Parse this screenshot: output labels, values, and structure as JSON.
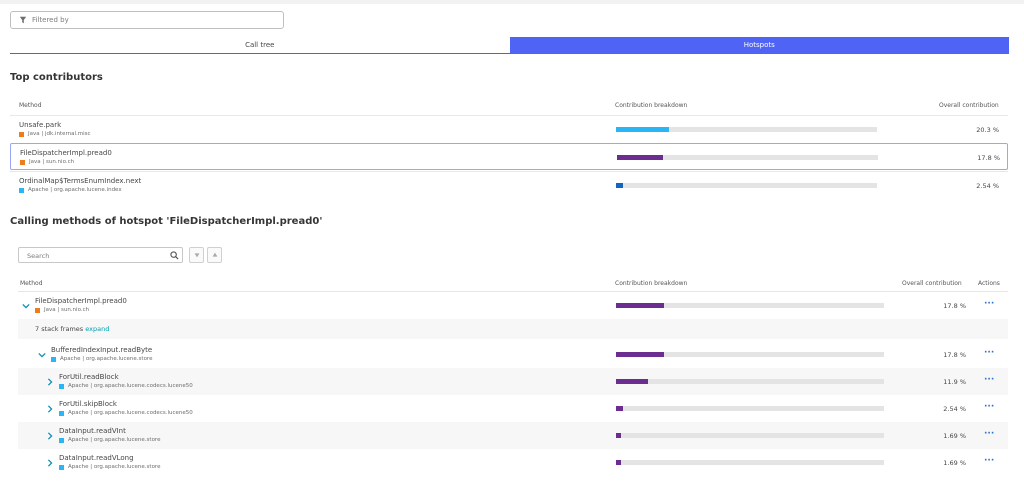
{
  "filter": {
    "placeholder": "Filtered by"
  },
  "tabs": [
    {
      "label": "Call tree",
      "active": false
    },
    {
      "label": "Hotspots",
      "active": true
    }
  ],
  "top_contributors": {
    "title": "Top contributors",
    "headers": {
      "method": "Method",
      "breakdown": "Contribution breakdown",
      "overall": "Overall contribution"
    },
    "rows": [
      {
        "name": "Unsafe.park",
        "meta": "Java | jdk.internal.misc",
        "color": "#ef7c1a",
        "bar_color": "#2ab6f4",
        "fraction": 0.203,
        "pct": "20.3 %",
        "selected": false
      },
      {
        "name": "FileDispatcherImpl.pread0",
        "meta": "Java | sun.nio.ch",
        "color": "#ef7c1a",
        "bar_color": "#6b2d8f",
        "fraction": 0.178,
        "pct": "17.8 %",
        "selected": true
      },
      {
        "name": "OrdinalMap$TermsEnumIndex.next",
        "meta": "Apache | org.apache.lucene.index",
        "color": "#2ab6f4",
        "bar_color": "#1565c0",
        "fraction": 0.0254,
        "pct": "2.54 %",
        "selected": false
      }
    ]
  },
  "calling": {
    "title": "Calling methods of hotspot 'FileDispatcherImpl.pread0'",
    "search_placeholder": "Search",
    "headers": {
      "method": "Method",
      "breakdown": "Contribution breakdown",
      "overall": "Overall contribution",
      "actions": "Actions"
    },
    "stack_frames": {
      "text": "7 stack frames",
      "link": "expand"
    },
    "rows": [
      {
        "name": "FileDispatcherImpl.pread0",
        "meta": "Java | sun.nio.ch",
        "color": "#ef7c1a",
        "fraction": 0.178,
        "pct": "17.8 %",
        "expanded": true
      },
      {
        "name": "BufferedIndexInput.readByte",
        "meta": "Apache | org.apache.lucene.store",
        "color": "#2ab6f4",
        "fraction": 0.178,
        "pct": "17.8 %",
        "expanded": true
      },
      {
        "name": "ForUtil.readBlock",
        "meta": "Apache | org.apache.lucene.codecs.lucene50",
        "color": "#2ab6f4",
        "fraction": 0.119,
        "pct": "11.9 %",
        "expanded": false
      },
      {
        "name": "ForUtil.skipBlock",
        "meta": "Apache | org.apache.lucene.codecs.lucene50",
        "color": "#2ab6f4",
        "fraction": 0.0254,
        "pct": "2.54 %",
        "expanded": false
      },
      {
        "name": "DataInput.readVInt",
        "meta": "Apache | org.apache.lucene.store",
        "color": "#2ab6f4",
        "fraction": 0.0169,
        "pct": "1.69 %",
        "expanded": false
      },
      {
        "name": "DataInput.readVLong",
        "meta": "Apache | org.apache.lucene.store",
        "color": "#2ab6f4",
        "fraction": 0.0169,
        "pct": "1.69 %",
        "expanded": false
      }
    ],
    "bar_color": "#6b2d8f",
    "actions_label": "···"
  }
}
